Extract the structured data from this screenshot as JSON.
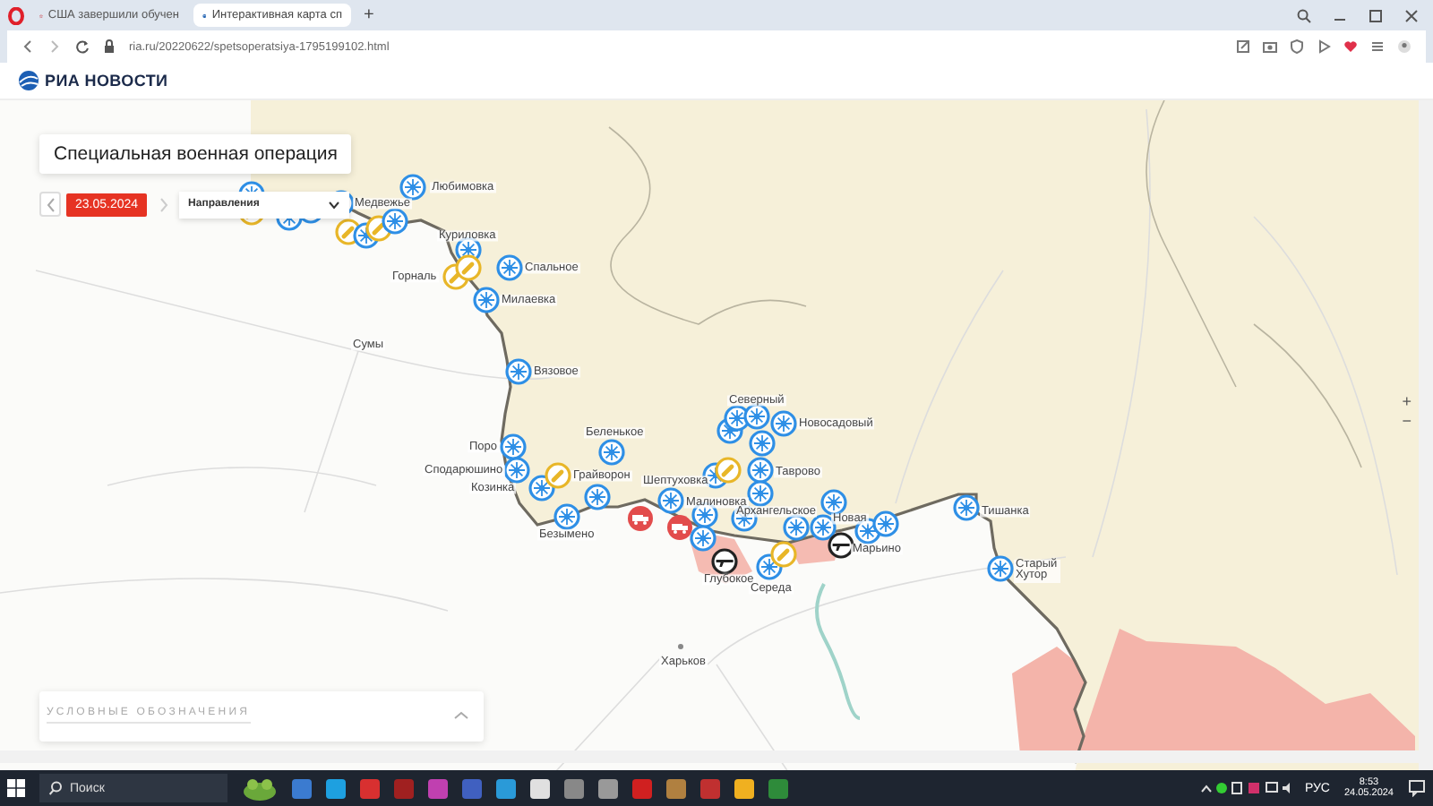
{
  "browser": {
    "tabs": [
      {
        "title": "США завершили обучен",
        "selected": false
      },
      {
        "title": "Интерактивная карта сп",
        "selected": true
      }
    ],
    "new_tab": "+",
    "url": "ria.ru/20220622/spetsoperatsiya-1795199102.html"
  },
  "site": {
    "logo": "РИА НОВОСТИ"
  },
  "map": {
    "title": "Специальная военная операция",
    "date": "23.05.2024",
    "directions": {
      "value": "Направления"
    },
    "places": [
      "Любимовка",
      "Медвежье",
      "Куриловка",
      "Горналь",
      "Спальное",
      "Милаевка",
      "Сумы",
      "Вязовое",
      "Поро",
      "Сподарюшино",
      "Козинка",
      "Беленькое",
      "Грайворон",
      "Безымено",
      "Шептуховка",
      "Малиновка",
      "Северный",
      "Новосадовый",
      "Таврово",
      "Архангельское",
      "Новая",
      "Глубокое",
      "Середа",
      "Марьино",
      "Тишанка",
      "Старый Хутор",
      "Харьков"
    ],
    "markers": [
      {
        "kind": "burst"
      },
      {
        "kind": "burst"
      },
      {
        "kind": "burst"
      },
      {
        "kind": "burst"
      },
      {
        "kind": "shell"
      },
      {
        "kind": "shell"
      },
      {
        "kind": "burst"
      },
      {
        "kind": "shell"
      },
      {
        "kind": "burst"
      },
      {
        "kind": "burst"
      },
      {
        "kind": "burst"
      },
      {
        "kind": "shell"
      },
      {
        "kind": "shell"
      },
      {
        "kind": "burst"
      },
      {
        "kind": "burst"
      },
      {
        "kind": "burst"
      },
      {
        "kind": "burst"
      },
      {
        "kind": "burst"
      },
      {
        "kind": "burst"
      },
      {
        "kind": "shell"
      },
      {
        "kind": "burst"
      },
      {
        "kind": "burst"
      },
      {
        "kind": "burst"
      },
      {
        "kind": "vehicle"
      },
      {
        "kind": "vehicle"
      },
      {
        "kind": "burst"
      },
      {
        "kind": "burst"
      },
      {
        "kind": "burst"
      },
      {
        "kind": "burst"
      },
      {
        "kind": "burst"
      },
      {
        "kind": "burst"
      },
      {
        "kind": "burst"
      },
      {
        "kind": "burst"
      },
      {
        "kind": "burst"
      },
      {
        "kind": "shell"
      },
      {
        "kind": "burst"
      },
      {
        "kind": "burst"
      },
      {
        "kind": "burst"
      },
      {
        "kind": "rifle"
      },
      {
        "kind": "burst"
      },
      {
        "kind": "shell"
      },
      {
        "kind": "burst"
      },
      {
        "kind": "burst"
      },
      {
        "kind": "burst"
      },
      {
        "kind": "rifle"
      },
      {
        "kind": "burst"
      },
      {
        "kind": "burst"
      },
      {
        "kind": "burst"
      },
      {
        "kind": "burst"
      }
    ],
    "zoom_controls": [
      "+",
      "−"
    ],
    "legend": {
      "title": "УСЛОВНЫЕ ОБОЗНАЧЕНИЯ",
      "expanded": false
    }
  },
  "taskbar": {
    "search": {
      "placeholder": "Поиск"
    },
    "language": "РУС",
    "time": "8:53",
    "date": "24.05.2024"
  }
}
